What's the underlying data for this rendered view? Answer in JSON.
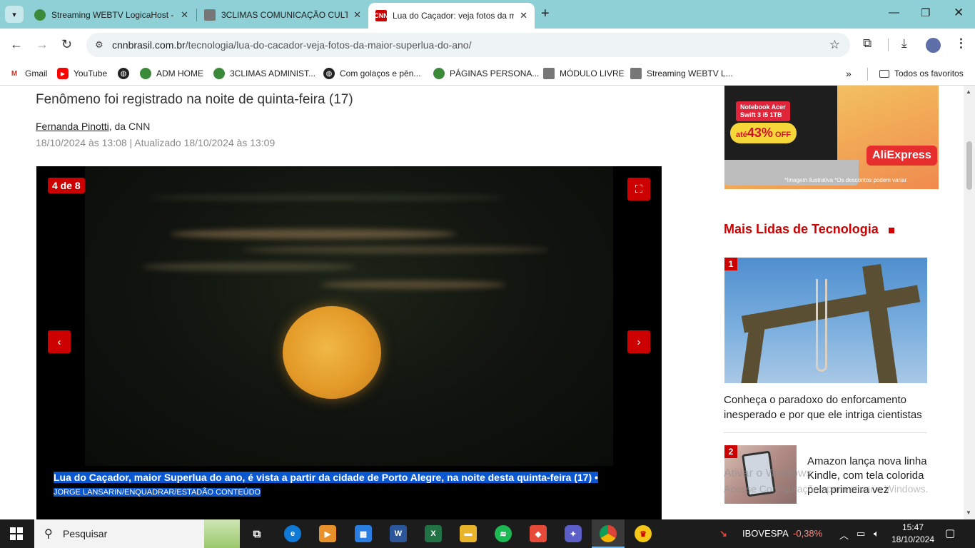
{
  "browser": {
    "tabs": [
      {
        "title": "Streaming WEBTV LogicaHost -",
        "favicon": "globe-green-icon"
      },
      {
        "title": "3CLIMAS COMUNICAÇÃO CULT",
        "favicon": "clapper-icon"
      },
      {
        "title": "Lua do Caçador: veja fotos da m",
        "favicon": "cnn-icon",
        "active": true
      }
    ],
    "url_domain": "cnnbrasil.com.br",
    "url_path": "/tecnologia/lua-do-cacador-veja-fotos-da-maior-superlua-do-ano/",
    "bookmarks": [
      {
        "label": "Gmail",
        "icon": "gmail-icon"
      },
      {
        "label": "YouTube",
        "icon": "youtube-icon"
      },
      {
        "label": "",
        "icon": "globe-icon"
      },
      {
        "label": "ADM HOME",
        "icon": "globe-green-icon"
      },
      {
        "label": "3CLIMAS ADMINIST...",
        "icon": "globe-green-icon"
      },
      {
        "label": "Com golaços e pên...",
        "icon": "globe-icon"
      },
      {
        "label": "PÁGINAS PERSONA...",
        "icon": "globe-green-icon"
      },
      {
        "label": "MÓDULO LIVRE",
        "icon": "clapper-icon"
      },
      {
        "label": "Streaming WEBTV L...",
        "icon": "clapper-icon"
      }
    ],
    "all_bookmarks": "Todos os favoritos"
  },
  "article": {
    "subtitle": "Fenômeno foi registrado na noite de quinta-feira (17)",
    "author": "Fernanda Pinotti",
    "source": ", da CNN",
    "dates": "18/10/2024 às 13:08 | Atualizado 18/10/2024 às 13:09",
    "gallery": {
      "counter": "4 de 8",
      "caption": "Lua do Caçador, maior Superlua do ano, é vista a partir da cidade de Porto Alegre, na noite desta quinta-feira (17) •",
      "credit": "JORGE LANSARIN/ENQUADRAR/ESTADÃO CONTEÚDO"
    }
  },
  "ad": {
    "tag_line1": "Notebook Acer",
    "tag_line2": "Swift 3 i5 1TB",
    "off_prefix": "até",
    "off_value": "43%",
    "off_suffix": "OFF",
    "brand": "AliExpress",
    "fine_print": "*Imagem ilustrativa *Os descontos podem variar"
  },
  "sidebar": {
    "heading": "Mais Lidas de Tecnologia",
    "articles": [
      {
        "rank": "1",
        "title": "Conheça o paradoxo do enforcamento inesperado e por que ele intriga cientistas"
      },
      {
        "rank": "2",
        "title": "Amazon lança nova linha Kindle, com tela colorida pela primeira vez"
      }
    ]
  },
  "watermark": {
    "line1": "Ativar o Windows",
    "line2": "Acesse Configurações para ativar o Windows."
  },
  "taskbar": {
    "search_placeholder": "Pesquisar",
    "ticker_name": "IBOVESPA",
    "ticker_value": "-0,38%",
    "time": "15:47",
    "date": "18/10/2024"
  },
  "colors": {
    "accent": "#cc0000",
    "tabstrip": "#8fd0d6",
    "selection": "#0b57d0"
  }
}
